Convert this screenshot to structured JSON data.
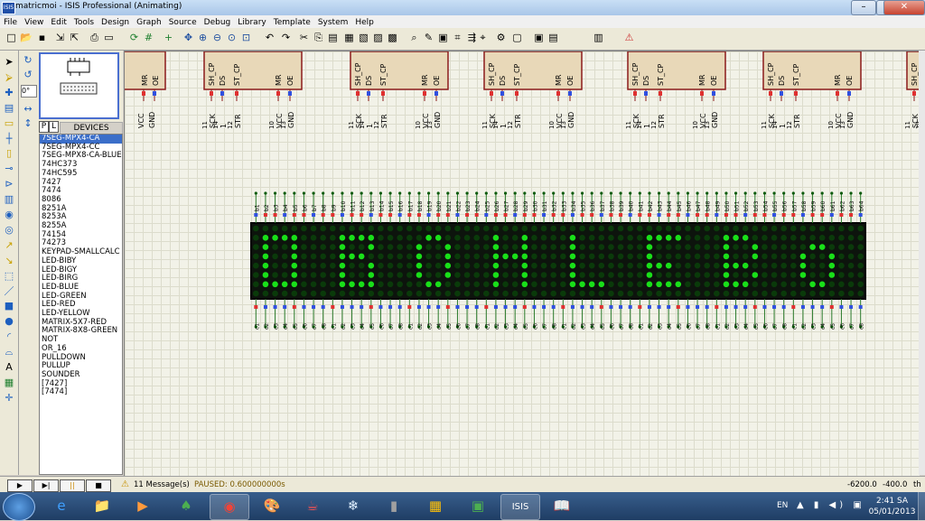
{
  "window": {
    "title": "matricmoi - ISIS Professional (Animating)",
    "app_icon": "ISIS"
  },
  "window_buttons": {
    "minimize": "–",
    "maximize": "▭",
    "close": "✕"
  },
  "menu": [
    "File",
    "View",
    "Edit",
    "Tools",
    "Design",
    "Graph",
    "Source",
    "Debug",
    "Library",
    "Template",
    "System",
    "Help"
  ],
  "toolbar": {
    "icons": [
      "new-file",
      "open-folder",
      "save",
      "import",
      "export",
      "print",
      "print-area",
      "refresh",
      "grid",
      "origin",
      "pan",
      "zoom-in",
      "zoom-out",
      "zoom-all",
      "zoom-area",
      "undo",
      "redo",
      "cut",
      "copy",
      "paste",
      "block-copy",
      "block-move",
      "block-rotate",
      "block-delete",
      "pick-devices",
      "make-device",
      "package",
      "decompose",
      "wire-autorouter",
      "search-tag",
      "property-assign",
      "new-sheet",
      "remove-sheet",
      "netlist",
      "bill-of-materials",
      "electrical-check"
    ]
  },
  "sidebar_tools": [
    "selection",
    "component",
    "junction-dot",
    "wire-label",
    "text-script",
    "bus",
    "subcircuit",
    "terminals",
    "device-pins",
    "graph",
    "tape-recorder",
    "generators",
    "voltage-probe",
    "current-probe",
    "virtual-instruments",
    "line-2d",
    "box-2d",
    "circle-2d",
    "arc-2d",
    "path-2d",
    "text-2d",
    "symbol",
    "marker"
  ],
  "rotation": {
    "value": "0°"
  },
  "picker": {
    "p_label": "P",
    "l_label": "L",
    "devices_label": "DEVICES"
  },
  "devices": [
    "7SEG-MPX4-CA",
    "7SEG-MPX4-CC",
    "7SEG-MPX8-CA-BLUE",
    "74HC373",
    "74HC595",
    "7427",
    "7474",
    "8086",
    "8251A",
    "8253A",
    "8255A",
    "74154",
    "74273",
    "KEYPAD-SMALLCALC",
    "LED-BIBY",
    "LED-BIGY",
    "LED-BIRG",
    "LED-BLUE",
    "LED-GREEN",
    "LED-RED",
    "LED-YELLOW",
    "MATRIX-5X7-RED",
    "MATRIX-8X8-GREEN",
    "NOT",
    "OR_16",
    "PULLDOWN",
    "PULLUP",
    "SOUNDER",
    "[7427]",
    "[7474]"
  ],
  "selected_device": "7SEG-MPX4-CA",
  "schematic": {
    "chip_top_labels": [
      "SH_CP",
      "DS",
      "ST_CP",
      "MR",
      "OE"
    ],
    "chip_pin_labels": [
      "SCK",
      "1",
      "STR",
      "VCC",
      "GND"
    ],
    "chip_pin_numbers": [
      "11",
      "14",
      "12",
      "10",
      "13"
    ],
    "matrix_top_prefix": "b",
    "matrix_bottom_prefix": "c",
    "matrix_columns": 64,
    "led_on_color": "#19e019",
    "led_off_color": "#0a3a0a",
    "matrix_bg": "#0d140d"
  },
  "simulation": {
    "play": "▶",
    "step": "▶|",
    "pause": "||",
    "stop": "■"
  },
  "status": {
    "messages": "11 Message(s)",
    "paused": "PAUSED: 0.600000000s",
    "coord_x": "-6200.0",
    "coord_y": "-400.0",
    "unit": "th"
  },
  "taskbar": {
    "lang": "EN",
    "time": "2:41 SA",
    "date": "05/01/2013",
    "apps": [
      "ie-icon",
      "explorer-icon",
      "media-player-icon",
      "isis-game-icon",
      "chrome-icon",
      "paint-icon",
      "teapot-icon",
      "snowflake-icon",
      "photo-icon",
      "chip-icon",
      "board-icon",
      "isis-icon",
      "book-icon"
    ]
  }
}
